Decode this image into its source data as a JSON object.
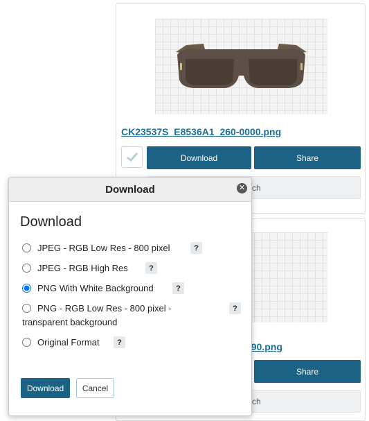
{
  "card1": {
    "filename": "CK23537S_E8536A1_260-0000.png",
    "download_label": "Download",
    "share_label": "Share",
    "search_label_partial": "ch"
  },
  "card2": {
    "filename_partial": "090.png",
    "share_label": "Share",
    "search_label_partial": "ch"
  },
  "modal": {
    "title": "Download",
    "subtitle": "Download",
    "options": [
      {
        "label": "JPEG - RGB Low Res - 800 pixel",
        "selected": false
      },
      {
        "label": "JPEG - RGB High Res",
        "selected": false
      },
      {
        "label": "PNG With White Background",
        "selected": true
      },
      {
        "label": "PNG - RGB Low Res - 800 pixel - transparent background",
        "selected": false
      },
      {
        "label": "Original Format",
        "selected": false
      }
    ],
    "help_glyph": "?",
    "close_glyph": "✕",
    "download_button": "Download",
    "cancel_button": "Cancel"
  },
  "colors": {
    "primary": "#1c6285",
    "link": "#1f6e96"
  }
}
